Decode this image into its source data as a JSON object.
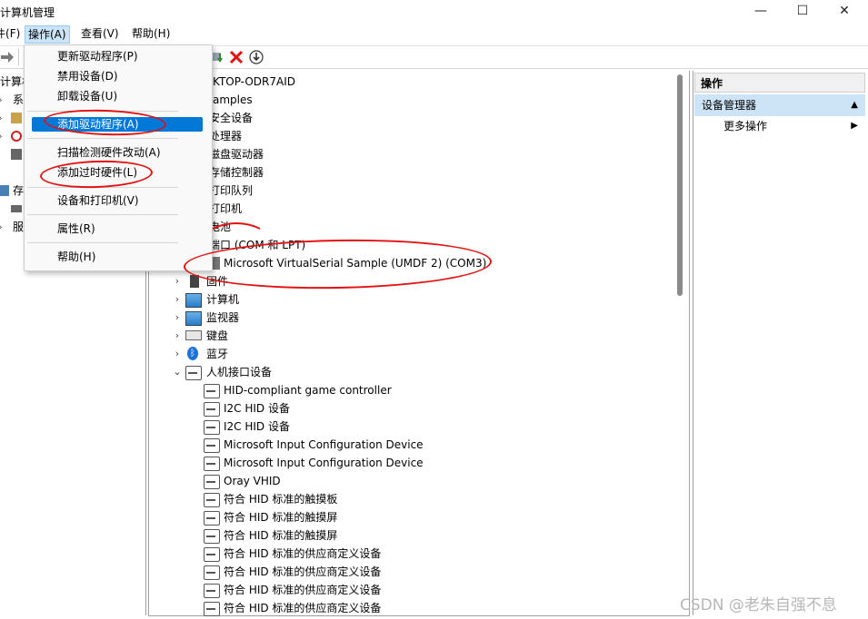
{
  "window": {
    "title": "计算机管理",
    "controls": {
      "minimize": "—",
      "maximize": "☐",
      "close": "✕"
    }
  },
  "menubar": {
    "file": "(F)",
    "file_prefix": "件",
    "action": "操作(A)",
    "view": "查看(V)",
    "help": "帮助(H)"
  },
  "toolbar": {
    "icons": [
      "back-arrow-icon",
      "forward-arrow-icon",
      "update-driver-icon",
      "uninstall-red-x-icon",
      "disable-down-arrow-icon"
    ],
    "colors": {
      "delete": "#e31212",
      "update": "#2e8b2e"
    }
  },
  "left_tree": {
    "root": "计算机",
    "items": [
      {
        "label": "系",
        "icon": "tools-icon"
      },
      {
        "label": "",
        "icon": "event-viewer-icon"
      },
      {
        "label": "",
        "icon": "users-icon"
      },
      {
        "label": "",
        "icon": "device-manager-icon"
      },
      {
        "label": "存",
        "icon": "storage-icon"
      },
      {
        "label": "",
        "icon": "disk-icon"
      },
      {
        "label": "服",
        "icon": "services-icon"
      }
    ]
  },
  "dropdown": {
    "items": [
      {
        "label": "更新驱动程序(P)"
      },
      {
        "label": "禁用设备(D)"
      },
      {
        "label": "卸载设备(U)"
      },
      {
        "label": "添加驱动程序(A)",
        "highlighted": true
      },
      {
        "label": "扫描检测硬件改动(A)"
      },
      {
        "label": "添加过时硬件(L)"
      },
      {
        "label": "设备和打印机(V)"
      },
      {
        "label": "属性(R)"
      },
      {
        "label": "帮助(H)"
      }
    ]
  },
  "device_tree": {
    "top_rows": [
      "KTOP-ODR7AID",
      "amples",
      "安全设备",
      "处理器",
      "磁盘驱动器",
      "存储控制器",
      "打印队列",
      "打印机",
      "电池",
      "端口 (COM 和 LPT)"
    ],
    "port_child": "Microsoft VirtualSerial Sample (UMDF 2) (COM3)",
    "categories": [
      {
        "label": "固件",
        "icon": "firmware-icon"
      },
      {
        "label": "计算机",
        "icon": "computer-icon"
      },
      {
        "label": "监视器",
        "icon": "monitor-icon"
      },
      {
        "label": "键盘",
        "icon": "keyboard-icon"
      },
      {
        "label": "蓝牙",
        "icon": "bluetooth-icon"
      }
    ],
    "hid_category": "人机接口设备",
    "hid_devices": [
      "HID-compliant game controller",
      "I2C HID 设备",
      "I2C HID 设备",
      "Microsoft Input Configuration Device",
      "Microsoft Input Configuration Device",
      "Oray VHID",
      "符合 HID 标准的触摸板",
      "符合 HID 标准的触摸屏",
      "符合 HID 标准的触摸屏",
      "符合 HID 标准的供应商定义设备",
      "符合 HID 标准的供应商定义设备",
      "符合 HID 标准的供应商定义设备",
      "符合 HID 标准的供应商定义设备"
    ]
  },
  "actions_pane": {
    "header": "操作",
    "section": "设备管理器",
    "more": "更多操作"
  },
  "watermark": "CSDN @老朱自强不息",
  "annotation_color": "#e31212"
}
